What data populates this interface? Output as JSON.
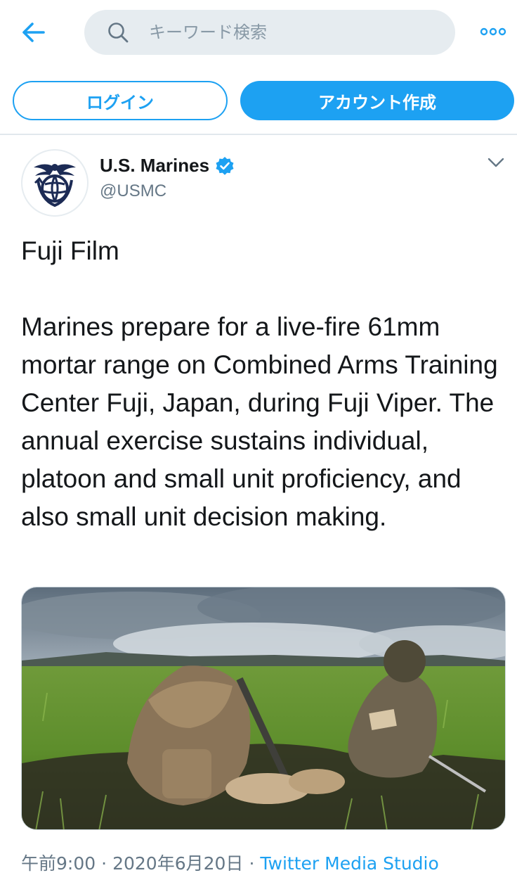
{
  "header": {
    "search_placeholder": "キーワード検索"
  },
  "auth": {
    "login_label": "ログイン",
    "signup_label": "アカウント作成"
  },
  "tweet": {
    "display_name": "U.S. Marines",
    "handle": "@USMC",
    "verified": true,
    "text": "Fuji Film\n\nMarines prepare for a live-fire 61mm mortar range on Combined Arms Training Center Fuji, Japan, during Fuji Viper. The annual exercise sustains individual, platoon and small unit proficiency, and also small unit decision making.",
    "time": "午前9:00",
    "date": "2020年6月20日",
    "separator": "·",
    "source": "Twitter Media Studio"
  },
  "icons": {
    "back": "back-arrow-icon",
    "search": "search-icon",
    "more": "more-icon",
    "verified": "verified-badge-icon",
    "caret": "chevron-down-icon"
  },
  "colors": {
    "accent": "#1da1f2",
    "text": "#14171a",
    "muted": "#657786",
    "search_bg": "#e6ecf0",
    "logo": "#1c2b55"
  }
}
